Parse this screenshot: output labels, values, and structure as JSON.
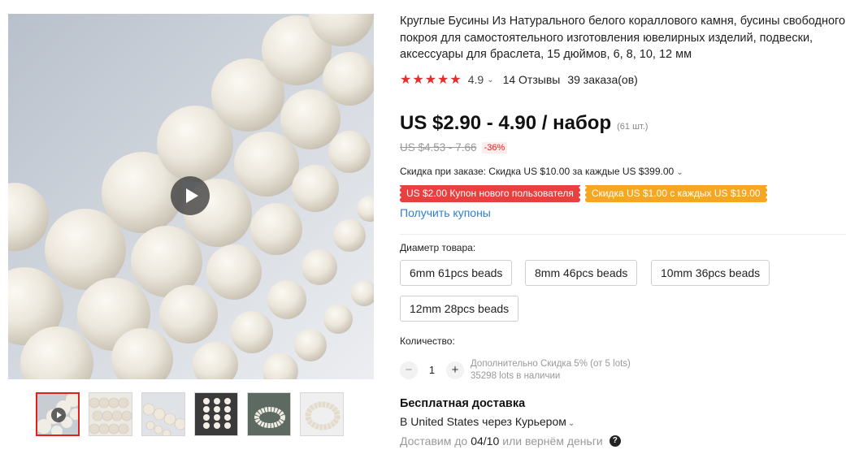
{
  "product": {
    "title": "Круглые Бусины Из Натурального белого кораллового камня, бусины свободного покроя для самостоятельного изготовления ювелирных изделий, подвески, аксессуары для браслета, 15 дюймов, 6, 8, 10, 12 мм"
  },
  "rating": {
    "value": "4.9",
    "stars": 5,
    "reviews": "14 Отзывы",
    "orders": "39 заказа(ов)"
  },
  "price": {
    "range": "US $2.90 - 4.90 / набор",
    "count": "(61 шт.)",
    "old": "US $4.53 - 7.66",
    "discount": "-36%"
  },
  "order_discount": "Скидка при заказе: Скидка US $10.00 за каждые US $399.00",
  "coupons": [
    {
      "label": "US $2.00 Купон нового пользователя",
      "color": "#e83f3f"
    },
    {
      "label": "Скидка US $1.00 с каждых US $19.00",
      "color": "#f5a623"
    }
  ],
  "get_coupons": "Получить купоны",
  "property": {
    "label": "Диаметр товара:",
    "options": [
      "6mm 61pcs beads",
      "8mm 46pcs beads",
      "10mm 36pcs beads",
      "12mm 28pcs beads"
    ]
  },
  "quantity": {
    "label": "Количество:",
    "minus": "−",
    "plus": "+",
    "value": "1",
    "note_discount": "Дополнительно Скидка 5% (от 5 lots)",
    "note_stock": "35298 lots в наличии"
  },
  "shipping": {
    "title": "Бесплатная доставка",
    "via": "В United States через Курьером",
    "delivery_prefix": "Доставим до",
    "delivery_date": "04/10",
    "delivery_suffix": "или вернём деньги",
    "help": "?"
  },
  "icons": {
    "star": "star-icon",
    "chevron": "chevron-down-icon",
    "play": "play-icon",
    "help": "question-icon"
  },
  "colors": {
    "accent_red": "#e2211c",
    "star": "#e62e2e",
    "link": "#2e7fd1",
    "coupon_red": "#e83f3f",
    "coupon_orange": "#f5a623"
  }
}
